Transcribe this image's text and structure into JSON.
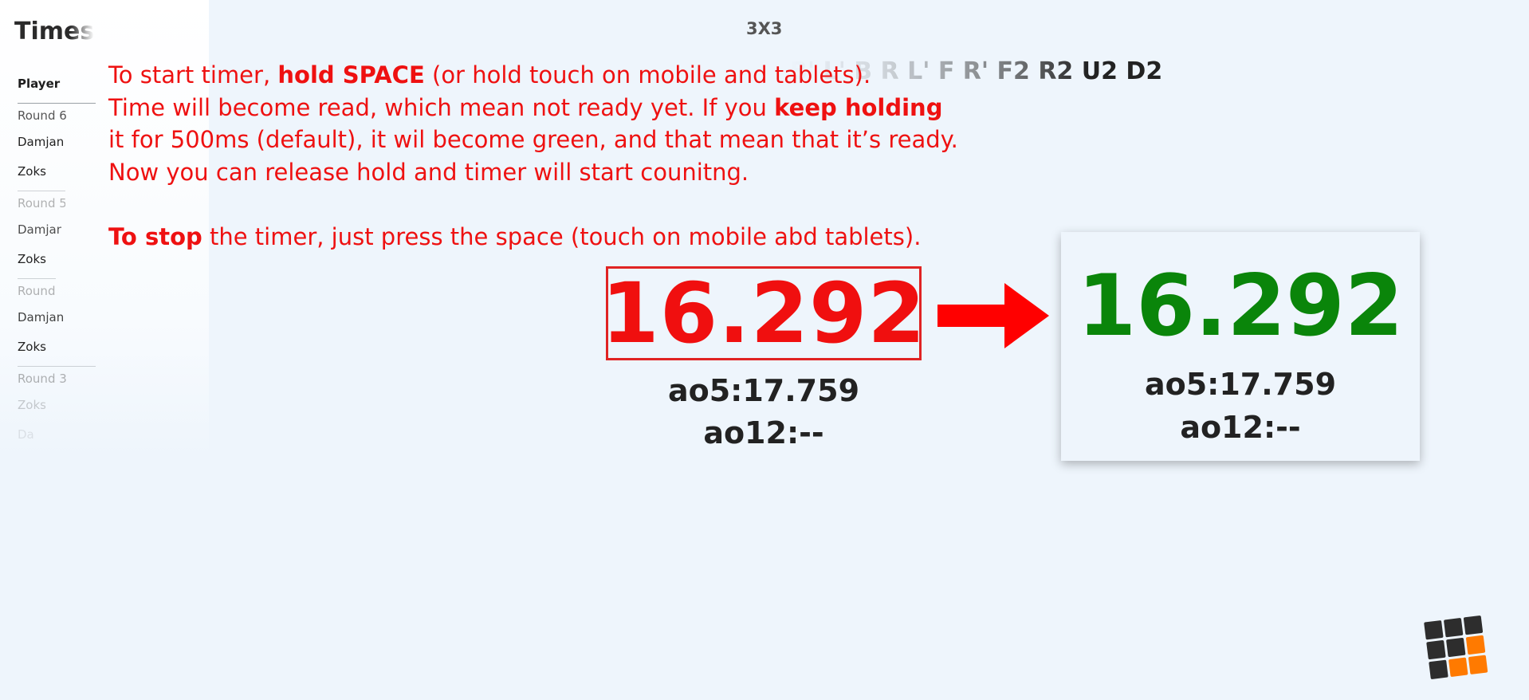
{
  "sidebar": {
    "title": "Times",
    "header": "Player",
    "rows": [
      {
        "kind": "round",
        "label": "Round 6"
      },
      {
        "kind": "player",
        "label": "Damjan"
      },
      {
        "kind": "player",
        "label": "Zoks"
      },
      {
        "kind": "round",
        "label": "Round 5"
      },
      {
        "kind": "player",
        "label": "Damjan"
      },
      {
        "kind": "player",
        "label": "Zoks"
      },
      {
        "kind": "round",
        "label": "Round 4"
      },
      {
        "kind": "player",
        "label": "Damjan"
      },
      {
        "kind": "player",
        "label": "Zoks"
      },
      {
        "kind": "round",
        "label": "Round 3"
      },
      {
        "kind": "player",
        "label": "Zoks"
      },
      {
        "kind": "player",
        "label": "Damjan"
      }
    ]
  },
  "header": {
    "puzzle_type": "3X3",
    "scramble": "B' L' B R L' F R' F2 R2 U2 D2"
  },
  "instructions": {
    "line1_a": "To start timer, ",
    "line1_b": "hold SPACE",
    "line1_c": " (or hold touch on mobile and tablets).",
    "line2_a": "Time will become read, which mean not ready yet. If you ",
    "line2_b": "keep holding",
    "line3": "it for 500ms (default), it wil become green, and that mean that it’s ready.",
    "line4": "Now you can release hold and timer will start counitng.",
    "line5_a": "To stop",
    "line5_b": " the timer, just press the space (touch on mobile abd tablets)."
  },
  "timer_not_ready": {
    "time": "16.292",
    "ao5": "ao5:17.759",
    "ao12": "ao12:--",
    "color": "#f00f0f"
  },
  "timer_ready": {
    "time": "16.292",
    "ao5": "ao5:17.759",
    "ao12": "ao12:--",
    "color": "#0a850a"
  },
  "arrow": {
    "icon": "right-arrow-icon",
    "color": "#ff0000"
  },
  "logo": {
    "icon": "cube-logo-icon",
    "colors": [
      "#2d2d2d",
      "#ff7a00"
    ]
  }
}
